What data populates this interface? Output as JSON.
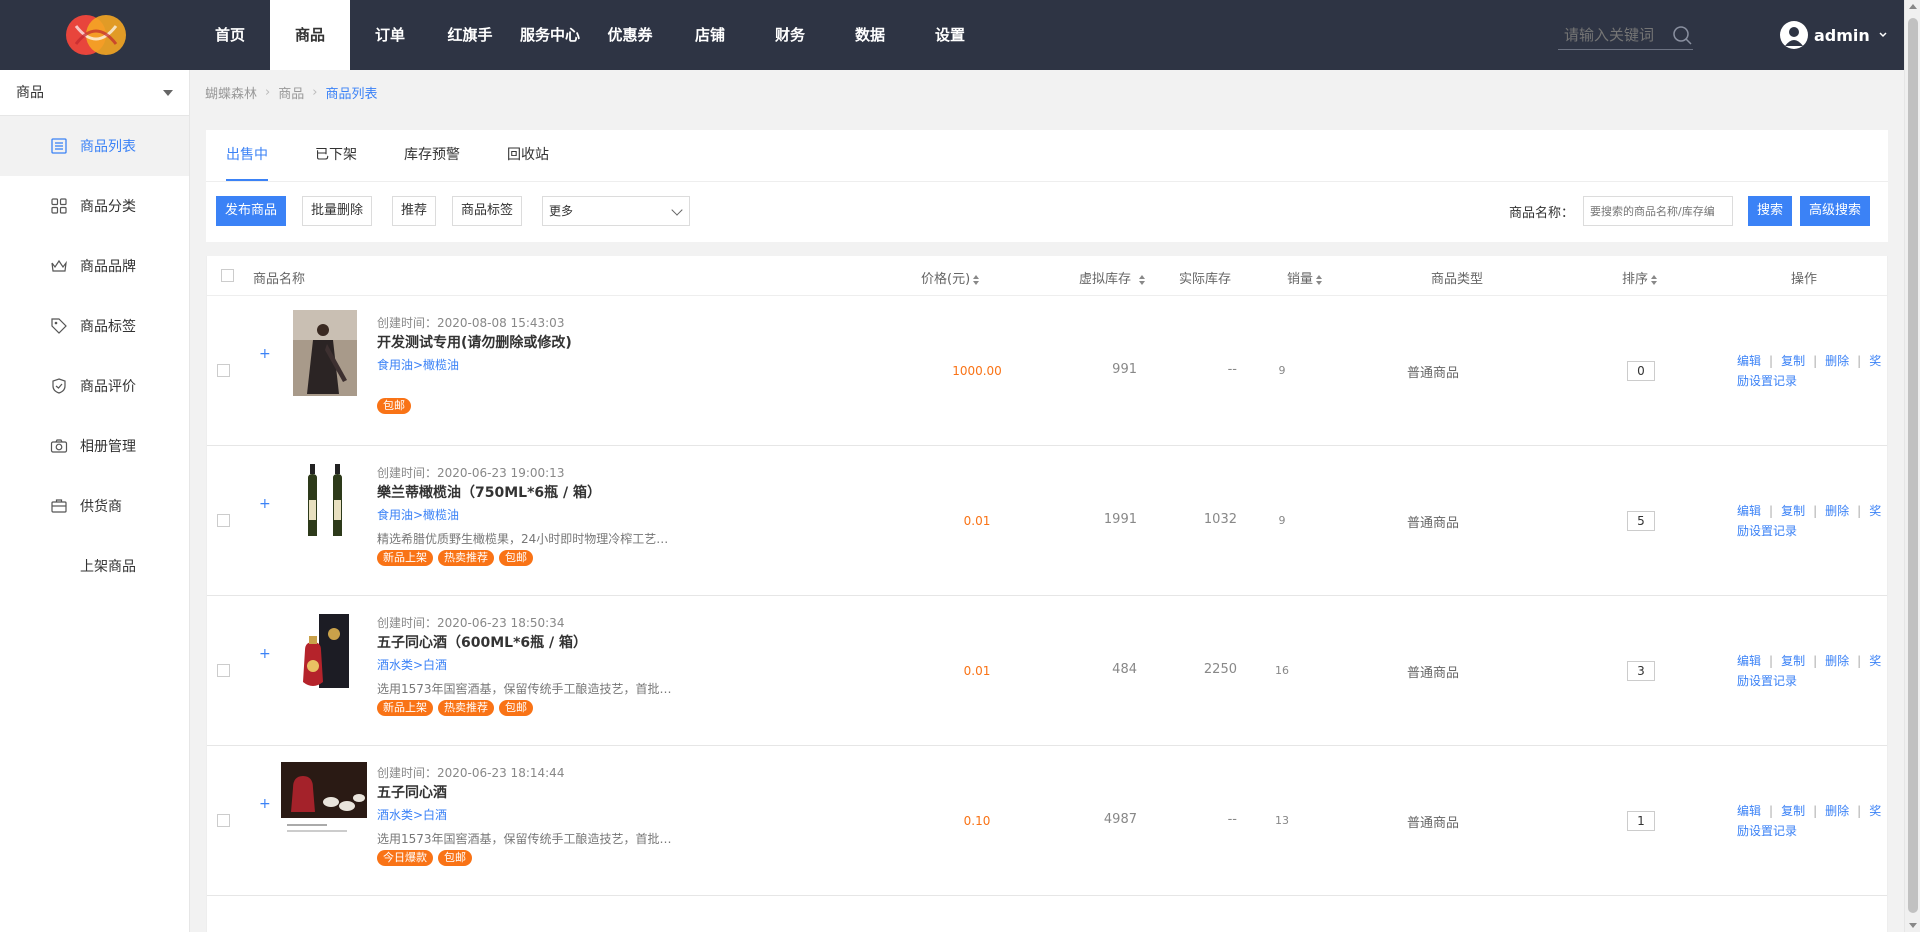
{
  "topbar": {
    "nav": [
      "首页",
      "商品",
      "订单",
      "红旗手",
      "服务中心",
      "优惠券",
      "店铺",
      "财务",
      "数据",
      "设置"
    ],
    "active_nav": "商品",
    "search_placeholder": "请输入关键词",
    "username": "admin",
    "logo_colors": [
      "#e8453c",
      "#f5a623"
    ]
  },
  "sidebar": {
    "selector": "商品",
    "items": [
      {
        "label": "商品列表",
        "icon": "list-icon"
      },
      {
        "label": "商品分类",
        "icon": "grid-icon"
      },
      {
        "label": "商品品牌",
        "icon": "crown-icon"
      },
      {
        "label": "商品标签",
        "icon": "tag-icon"
      },
      {
        "label": "商品评价",
        "icon": "shield-icon"
      },
      {
        "label": "相册管理",
        "icon": "camera-icon"
      },
      {
        "label": "供货商",
        "icon": "briefcase-icon"
      },
      {
        "label": "上架商品",
        "icon": ""
      }
    ]
  },
  "breadcrumb": [
    "蝴蝶森林",
    "商品",
    "商品列表"
  ],
  "tabs": [
    "出售中",
    "已下架",
    "库存预警",
    "回收站"
  ],
  "toolbar": {
    "publish": "发布商品",
    "batch_delete": "批量删除",
    "recommend": "推荐",
    "label": "商品标签",
    "more": "更多",
    "filter_label": "商品名称：",
    "filter_placeholder": "要搜索的商品名称/库存编",
    "search": "搜索",
    "advanced": "高级搜索"
  },
  "table": {
    "headers": {
      "name": "商品名称",
      "price": "价格(元)",
      "vstock": "虚拟库存",
      "rstock": "实际库存",
      "sales": "销量",
      "type": "商品类型",
      "sort": "排序",
      "ops": "操作"
    },
    "rows": [
      {
        "ctime": "创建时间：2020-08-08 15:43:03",
        "name": "开发测试专用(请勿删除或修改)",
        "category": "食用油>橄榄油",
        "desc": "",
        "tags": [
          "包邮"
        ],
        "price": "1000.00",
        "vstock": "991",
        "rstock": "--",
        "sales": "9",
        "type": "普通商品",
        "sort": "0"
      },
      {
        "ctime": "创建时间：2020-06-23 19:00:13",
        "name": "樂兰蒂橄榄油（750ML*6瓶 / 箱）",
        "category": "食用油>橄榄油",
        "desc": "精选希腊优质野生橄榄果，24小时即时物理冷榨工艺，...",
        "tags": [
          "新品上架",
          "热卖推荐",
          "包邮"
        ],
        "price": "0.01",
        "vstock": "1991",
        "rstock": "1032",
        "sales": "9",
        "type": "普通商品",
        "sort": "5"
      },
      {
        "ctime": "创建时间：2020-06-23 18:50:34",
        "name": "五子同心酒（600ML*6瓶 / 箱）",
        "category": "酒水类>白酒",
        "desc": "选用1573年国窖酒基，保留传统手工酿造技艺，首批入...",
        "tags": [
          "新品上架",
          "热卖推荐",
          "包邮"
        ],
        "price": "0.01",
        "vstock": "484",
        "rstock": "2250",
        "sales": "16",
        "type": "普通商品",
        "sort": "3"
      },
      {
        "ctime": "创建时间：2020-06-23 18:14:44",
        "name": "五子同心酒",
        "category": "酒水类>白酒",
        "desc": "选用1573年国窖酒基，保留传统手工酿造技艺，首批入...",
        "tags": [
          "今日爆款",
          "包邮"
        ],
        "price": "0.10",
        "vstock": "4987",
        "rstock": "--",
        "sales": "13",
        "type": "普通商品",
        "sort": "1"
      }
    ],
    "ops": {
      "edit": "编辑",
      "copy": "复制",
      "delete": "删除",
      "reward": "奖励设置记录"
    }
  },
  "colors": {
    "accent": "#3b82f6",
    "topbar": "#2e3444",
    "tag": "#f97316"
  }
}
